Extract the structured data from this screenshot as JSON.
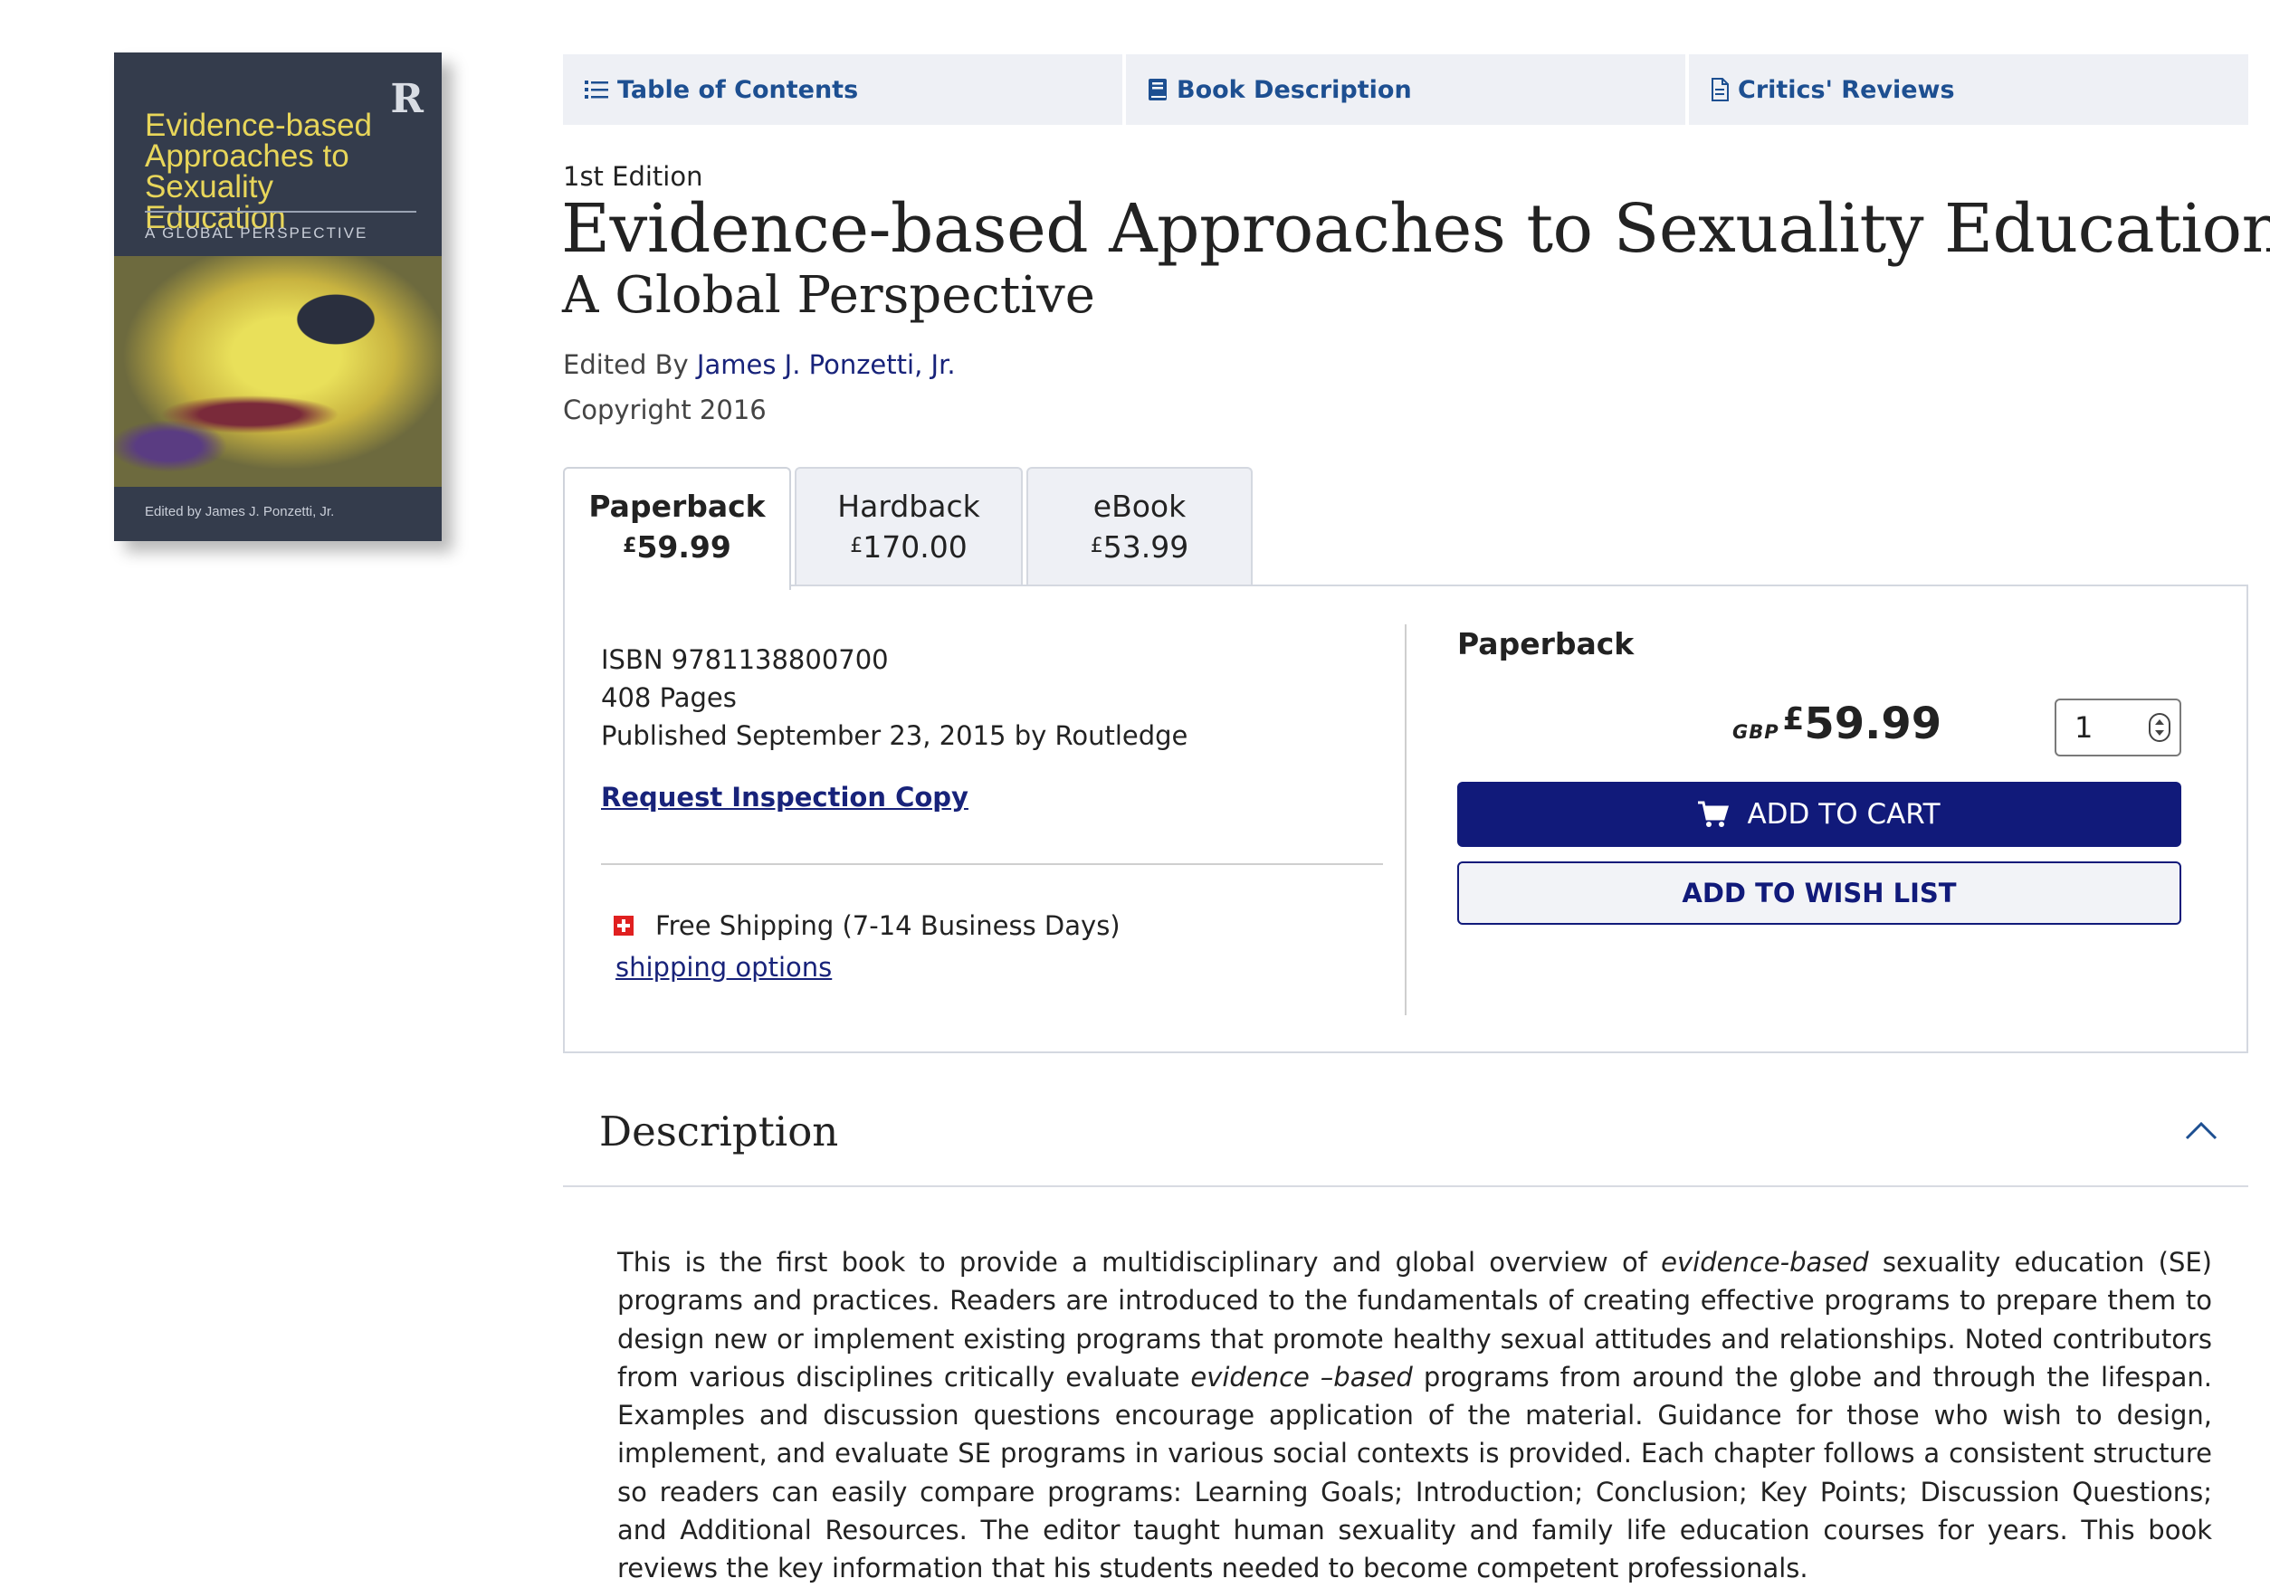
{
  "cover": {
    "logo": "R",
    "title": "Evidence-based Approaches to Sexuality Education",
    "subtitle": "A GLOBAL PERSPECTIVE",
    "editor": "Edited by James J. Ponzetti, Jr."
  },
  "nav": {
    "toc": "Table of Contents",
    "description": "Book Description",
    "reviews": "Critics' Reviews"
  },
  "book": {
    "edition": "1st Edition",
    "title": "Evidence-based Approaches to Sexuality Education",
    "subtitle": "A Global Perspective",
    "edited_by_label": "Edited By",
    "editor": "James J. Ponzetti, Jr.",
    "copyright": "Copyright 2016"
  },
  "formats": [
    {
      "name": "Paperback",
      "currency_symbol": "£",
      "price": "59.99",
      "selected": true
    },
    {
      "name": "Hardback",
      "currency_symbol": "£",
      "price": "170.00",
      "selected": false
    },
    {
      "name": "eBook",
      "currency_symbol": "£",
      "price": "53.99",
      "selected": false
    }
  ],
  "details": {
    "isbn": "ISBN 9781138800700",
    "pages": "408 Pages",
    "published": "Published September 23, 2015 by Routledge",
    "inspection_link": "Request Inspection Copy",
    "shipping": "Free Shipping (7-14 Business Days)",
    "shipping_options": "shipping options"
  },
  "purchase": {
    "format": "Paperback",
    "currency_code": "GBP",
    "currency_symbol": "£",
    "price": "59.99",
    "quantity": "1",
    "add_to_cart": "ADD TO CART",
    "add_to_wishlist": "ADD TO WISH LIST"
  },
  "description": {
    "heading": "Description",
    "p1": "This is the first book to provide a multidisciplinary and global overview of ",
    "em1": "evidence-based",
    "p2": " sexuality education (SE) programs and practices. Readers are introduced to the fundamentals of creating effective programs to prepare them to design new or implement existing programs that promote healthy sexual attitudes and relationships. Noted contributors from various disciplines critically evaluate ",
    "em2": "evidence –based",
    "p3": " programs from around the globe and through the lifespan. Examples and discussion questions encourage application of the material. Guidance for those who wish to design, implement, and evaluate SE programs in various social contexts is provided. Each chapter follows a consistent structure so readers can easily compare programs: Learning Goals; Introduction; Conclusion; Key Points; Discussion Questions; and Additional Resources. The editor taught human sexuality and family life education courses for years. This book reviews the key information that his students needed to become competent professionals."
  },
  "colors": {
    "primary_navy": "#111a7a",
    "link_blue": "#1d4f91",
    "tab_bg": "#eef0f5",
    "shipping_red": "#e02020"
  }
}
